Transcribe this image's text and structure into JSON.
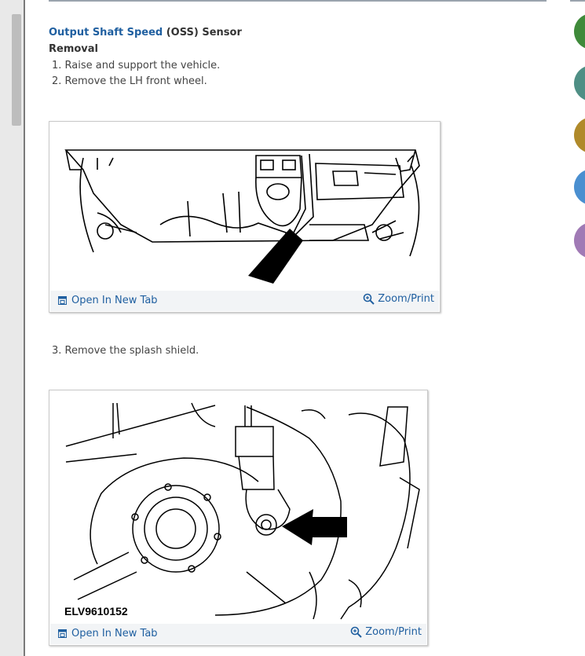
{
  "heading": {
    "link_text": "Output Shaft Speed",
    "rest_text": " (OSS) Sensor"
  },
  "subheading": "Removal",
  "steps": [
    "1. Raise and support the vehicle.",
    "2. Remove the LH front wheel.",
    "3. Remove the splash shield."
  ],
  "figures": [
    {
      "open_label": "Open In New Tab",
      "zoom_label": "Zoom/Print"
    },
    {
      "code": "ELV9610152",
      "open_label": "Open In New Tab",
      "zoom_label": "Zoom/Print"
    }
  ],
  "side_nav_colors": [
    "#3f8a3a",
    "#4f8f85",
    "#b08a2a",
    "#4a8fd0",
    "#a07ab5"
  ]
}
